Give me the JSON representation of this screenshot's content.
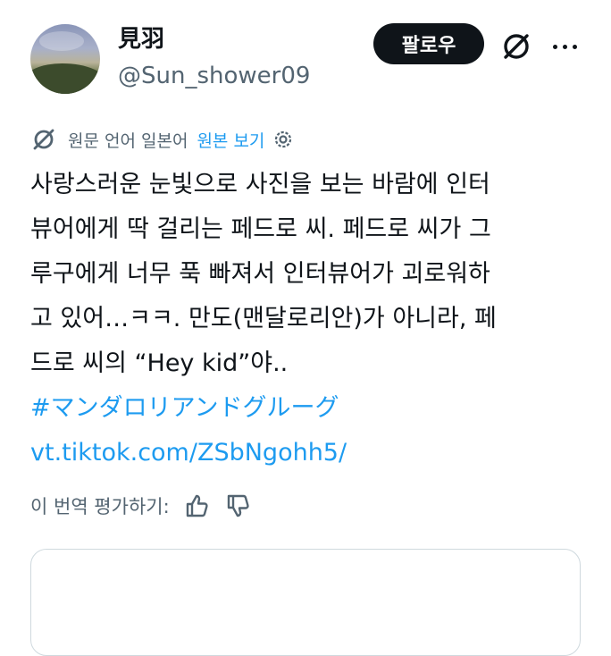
{
  "author": {
    "display_name": "見羽",
    "handle": "@Sun_shower09"
  },
  "actions": {
    "follow_label": "팔로우"
  },
  "translation": {
    "label": "원문 언어 일본어",
    "show_original": "원본 보기"
  },
  "tweet": {
    "lines": [
      "사랑스러운 눈빛으로 사진을 보는 바람에 인터",
      "뷰어에게 딱 걸리는 페드로 씨. 페드로 씨가 그",
      "루구에게 너무 푹 빠져서 인터뷰어가 괴로워하",
      "고 있어…ㅋㅋ. 만도(맨달로리안)가 아니라, 페",
      "드로 씨의 “Hey kid”야.."
    ],
    "hashtag": "#マンダロリアンドグルーグ",
    "link": "vt.tiktok.com/ZSbNgohh5/"
  },
  "rating": {
    "label": "이 번역 평가하기:"
  },
  "icons": {
    "grok": "grok-icon",
    "more": "more-icon",
    "translate": "translate-icon",
    "gear": "gear-icon",
    "thumbs_up": "thumbs-up-icon",
    "thumbs_down": "thumbs-down-icon"
  },
  "colors": {
    "accent": "#1d9bf0",
    "text": "#0f1419",
    "secondary": "#536471",
    "button_bg": "#0f1419"
  }
}
